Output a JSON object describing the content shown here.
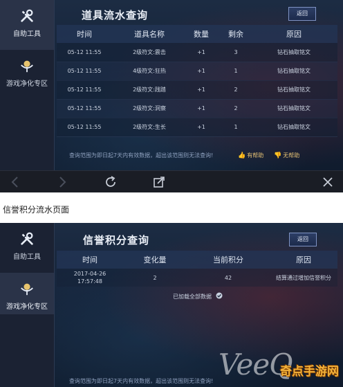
{
  "screen1": {
    "sidebar": {
      "items": [
        {
          "label": "自助工具",
          "icon": "tools-icon",
          "active": true
        },
        {
          "label": "游戏净化专区",
          "icon": "cleanup-icon",
          "active": false
        }
      ]
    },
    "title": "道具流水查询",
    "back_label": "返回",
    "columns": [
      "时间",
      "道具名称",
      "数量",
      "剩余",
      "原因"
    ],
    "rows": [
      [
        "05-12 11:55",
        "2级符文:震击",
        "+1",
        "3",
        "钻石抽取铭文"
      ],
      [
        "05-12 11:55",
        "4级符文:狂热",
        "+1",
        "1",
        "钻石抽取铭文"
      ],
      [
        "05-12 11:55",
        "2级符文:践踏",
        "+1",
        "2",
        "钻石抽取铭文"
      ],
      [
        "05-12 11:55",
        "2级符文:洞察",
        "+1",
        "2",
        "钻石抽取铭文"
      ],
      [
        "05-12 11:55",
        "2级符文:生长",
        "+1",
        "1",
        "钻石抽取铭文"
      ]
    ],
    "footer_note": "查询范围为即日起7天内有效数据，超出该范围则无法查询!",
    "helpful_label": "有帮助",
    "unhelpful_label": "无帮助"
  },
  "toolbar": {
    "icons": [
      "back-arrow-icon",
      "forward-arrow-icon",
      "refresh-icon",
      "share-icon",
      "close-icon"
    ]
  },
  "caption": "信誉积分流水页面",
  "screen2": {
    "sidebar": {
      "items": [
        {
          "label": "自助工具",
          "icon": "tools-icon",
          "active": false
        },
        {
          "label": "游戏净化专区",
          "icon": "cleanup-icon",
          "active": true
        }
      ]
    },
    "title": "信誉积分查询",
    "back_label": "返回",
    "columns": [
      "时间",
      "变化量",
      "当前积分",
      "原因"
    ],
    "rows": [
      {
        "date": "2017-04-26",
        "time": "17:57:48",
        "change": "2",
        "score": "42",
        "reason": "结算通过增加信誉积分"
      }
    ],
    "loaded_text": "已加载全部数据",
    "footer_note": "查询范围为即日起7天内有效数据，超出该范围则无法查询!"
  },
  "watermarks": {
    "brand": "VeeQ",
    "site": "奇点手游网"
  }
}
